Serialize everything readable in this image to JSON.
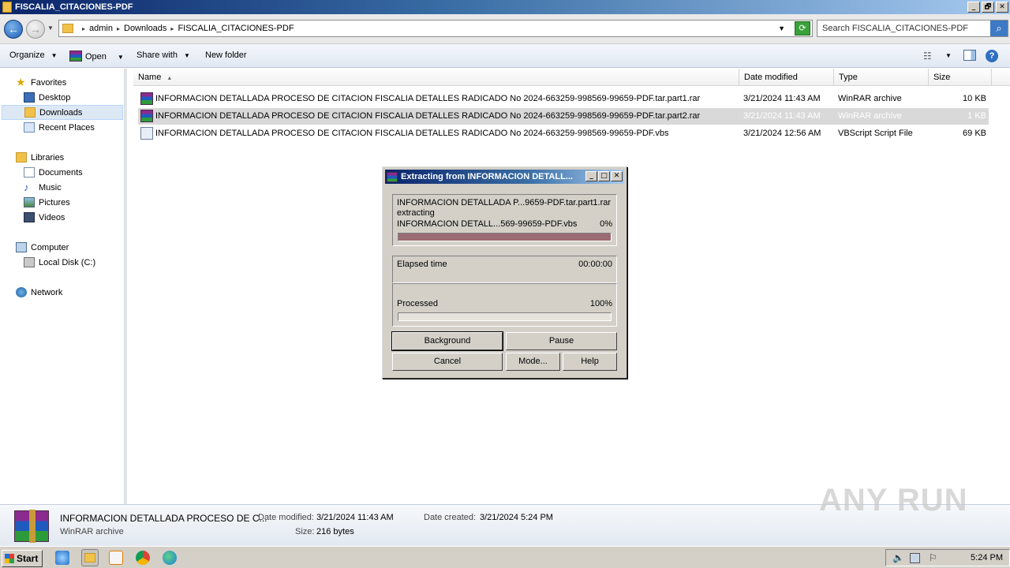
{
  "window": {
    "title": "FISCALIA_CITACIONES-PDF",
    "controls": [
      "_",
      "🗗",
      "✕"
    ]
  },
  "address": {
    "crumbs": [
      "admin",
      "Downloads",
      "FISCALIA_CITACIONES-PDF"
    ],
    "search_placeholder": "Search FISCALIA_CITACIONES-PDF"
  },
  "toolbar": {
    "organize": "Organize",
    "open": "Open",
    "share_with": "Share with",
    "new_folder": "New folder"
  },
  "sidebar": {
    "favorites": "Favorites",
    "desktop": "Desktop",
    "downloads": "Downloads",
    "recent_places": "Recent Places",
    "libraries": "Libraries",
    "documents": "Documents",
    "music": "Music",
    "pictures": "Pictures",
    "videos": "Videos",
    "computer": "Computer",
    "local_disk": "Local Disk (C:)",
    "network": "Network"
  },
  "columns": {
    "name": "Name",
    "date_modified": "Date modified",
    "type": "Type",
    "size": "Size"
  },
  "files": [
    {
      "name": "INFORMACION DETALLADA PROCESO DE CITACION FISCALIA DETALLES RADICADO No 2024-663259-998569-99659-PDF.tar.part1.rar",
      "date": "3/21/2024 11:43 AM",
      "type": "WinRAR archive",
      "size": "10 KB"
    },
    {
      "name": "INFORMACION DETALLADA PROCESO DE CITACION FISCALIA DETALLES RADICADO No 2024-663259-998569-99659-PDF.tar.part2.rar",
      "date": "3/21/2024 11:43 AM",
      "type": "WinRAR archive",
      "size": "1 KB"
    },
    {
      "name": "INFORMACION DETALLADA PROCESO DE CITACION FISCALIA DETALLES RADICADO No 2024-663259-998569-99659-PDF.vbs",
      "date": "3/21/2024 12:56 AM",
      "type": "VBScript Script File",
      "size": "69 KB"
    }
  ],
  "dialog": {
    "title": "Extracting from INFORMACION DETALL...",
    "archive": "INFORMACION DETALLADA P...9659-PDF.tar.part1.rar",
    "action": "extracting",
    "current_file": "INFORMACION DETALL...569-99659-PDF.vbs",
    "current_percent": "0%",
    "current_progress": 1.0,
    "elapsed_label": "Elapsed time",
    "elapsed_value": "00:00:00",
    "processed_label": "Processed",
    "processed_percent": "100%",
    "processed_progress": 0.0,
    "buttons": {
      "background": "Background",
      "pause": "Pause",
      "cancel": "Cancel",
      "mode": "Mode...",
      "help": "Help"
    }
  },
  "details": {
    "name": "INFORMACION DETALLADA PROCESO DE C...",
    "type": "WinRAR archive",
    "date_modified_label": "Date modified:",
    "date_modified": "3/21/2024 11:43 AM",
    "date_created_label": "Date created:",
    "date_created": "3/21/2024 5:24 PM",
    "size_label": "Size:",
    "size": "216 bytes"
  },
  "taskbar": {
    "start": "Start",
    "clock": "5:24 PM"
  },
  "watermark": "ANY RUN"
}
